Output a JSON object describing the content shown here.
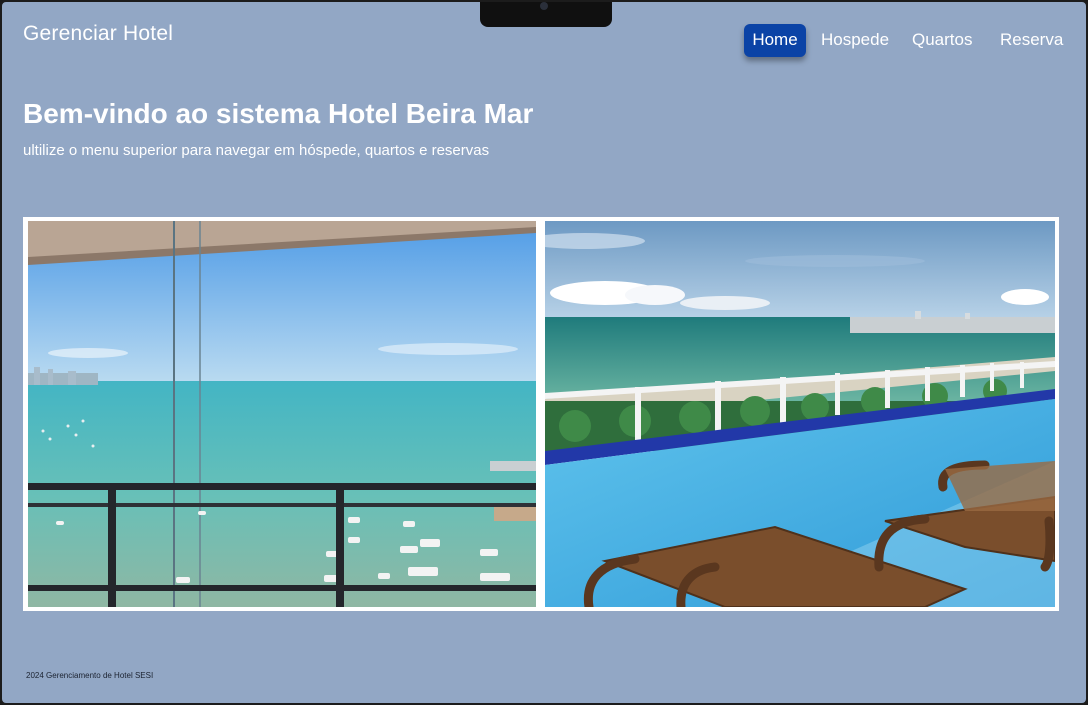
{
  "brand": "Gerenciar Hotel",
  "nav": {
    "items": [
      {
        "label": "Home",
        "active": true
      },
      {
        "label": "Hospede",
        "active": false
      },
      {
        "label": "Quartos",
        "active": false
      },
      {
        "label": "Reserva",
        "active": false
      }
    ]
  },
  "hero": {
    "title": "Bem-vindo ao sistema Hotel Beira Mar",
    "subtitle": "ultilize o menu superior para navegar em hóspede, quartos e reservas"
  },
  "gallery": {
    "images": [
      {
        "name": "balcony-sea-view-image"
      },
      {
        "name": "infinity-pool-image"
      }
    ]
  },
  "footer": {
    "text": "2024 Gerenciamento de Hotel SESI"
  },
  "colors": {
    "page_background": "#92a7c5",
    "nav_active": "#0b43a6",
    "text": "#ffffff"
  }
}
